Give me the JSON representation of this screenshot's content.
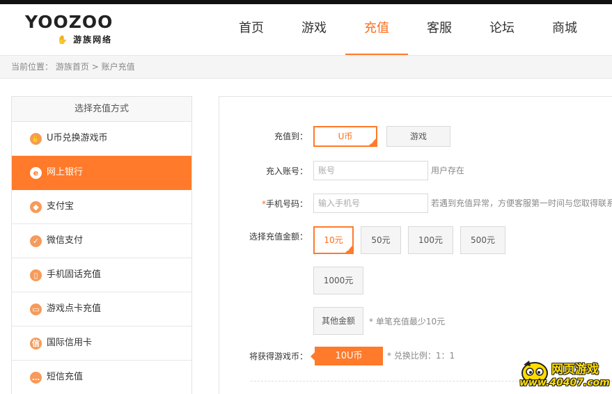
{
  "brand": {
    "logo_text": "YOOZOO",
    "logo_sub": "游族网络"
  },
  "nav": [
    {
      "label": "首页",
      "active": false
    },
    {
      "label": "游戏",
      "active": false
    },
    {
      "label": "充值",
      "active": true
    },
    {
      "label": "客服",
      "active": false
    },
    {
      "label": "论坛",
      "active": false
    },
    {
      "label": "商城",
      "active": false
    }
  ],
  "breadcrumb": {
    "prefix": "当前位置：",
    "home": "游族首页",
    "sep": ">",
    "current": "账户充值"
  },
  "sidebar": {
    "title": "选择充值方式",
    "items": [
      {
        "label": "U币兑换游戏币",
        "icon": "hand-icon",
        "glyph": "✋",
        "active": false
      },
      {
        "label": "网上银行",
        "icon": "ebank-icon",
        "glyph": "e",
        "active": true
      },
      {
        "label": "支付宝",
        "icon": "shield-icon",
        "glyph": "◆",
        "active": false
      },
      {
        "label": "微信支付",
        "icon": "chat-icon",
        "glyph": "✓",
        "active": false
      },
      {
        "label": "手机固话充值",
        "icon": "phone-icon",
        "glyph": "▯",
        "active": false
      },
      {
        "label": "游戏点卡充值",
        "icon": "card-icon",
        "glyph": "▭",
        "active": false
      },
      {
        "label": "国际信用卡",
        "icon": "credit-icon",
        "glyph": "信",
        "active": false
      },
      {
        "label": "短信充值",
        "icon": "sms-icon",
        "glyph": "…",
        "active": false
      }
    ]
  },
  "form": {
    "target_label": "充值到：",
    "target_options": [
      {
        "label": "U币",
        "selected": true
      },
      {
        "label": "游戏",
        "selected": false
      }
    ],
    "account_label": "充入账号：",
    "account_placeholder": "账号",
    "account_hint": "用户存在",
    "phone_req": "*",
    "phone_label": "手机号码：",
    "phone_placeholder": "输入手机号",
    "phone_hint": "若遇到充值异常，方便客服第一时间与您取得联系",
    "amount_label": "选择充值金额：",
    "amounts": [
      {
        "label": "10元",
        "selected": true
      },
      {
        "label": "50元",
        "selected": false
      },
      {
        "label": "100元",
        "selected": false
      },
      {
        "label": "500元",
        "selected": false
      },
      {
        "label": "1000元",
        "selected": false
      }
    ],
    "other_amount": "其他金额",
    "other_hint": "* 单笔充值最少10元",
    "receive_label": "将获得游戏币：",
    "receive_value": "10U币",
    "ratio_hint": "* 兑换比例：1：1"
  },
  "watermark": {
    "title": "网页游戏",
    "url": "www.40407.com"
  },
  "colors": {
    "accent": "#ff7a2a",
    "topbar": "#111111"
  }
}
